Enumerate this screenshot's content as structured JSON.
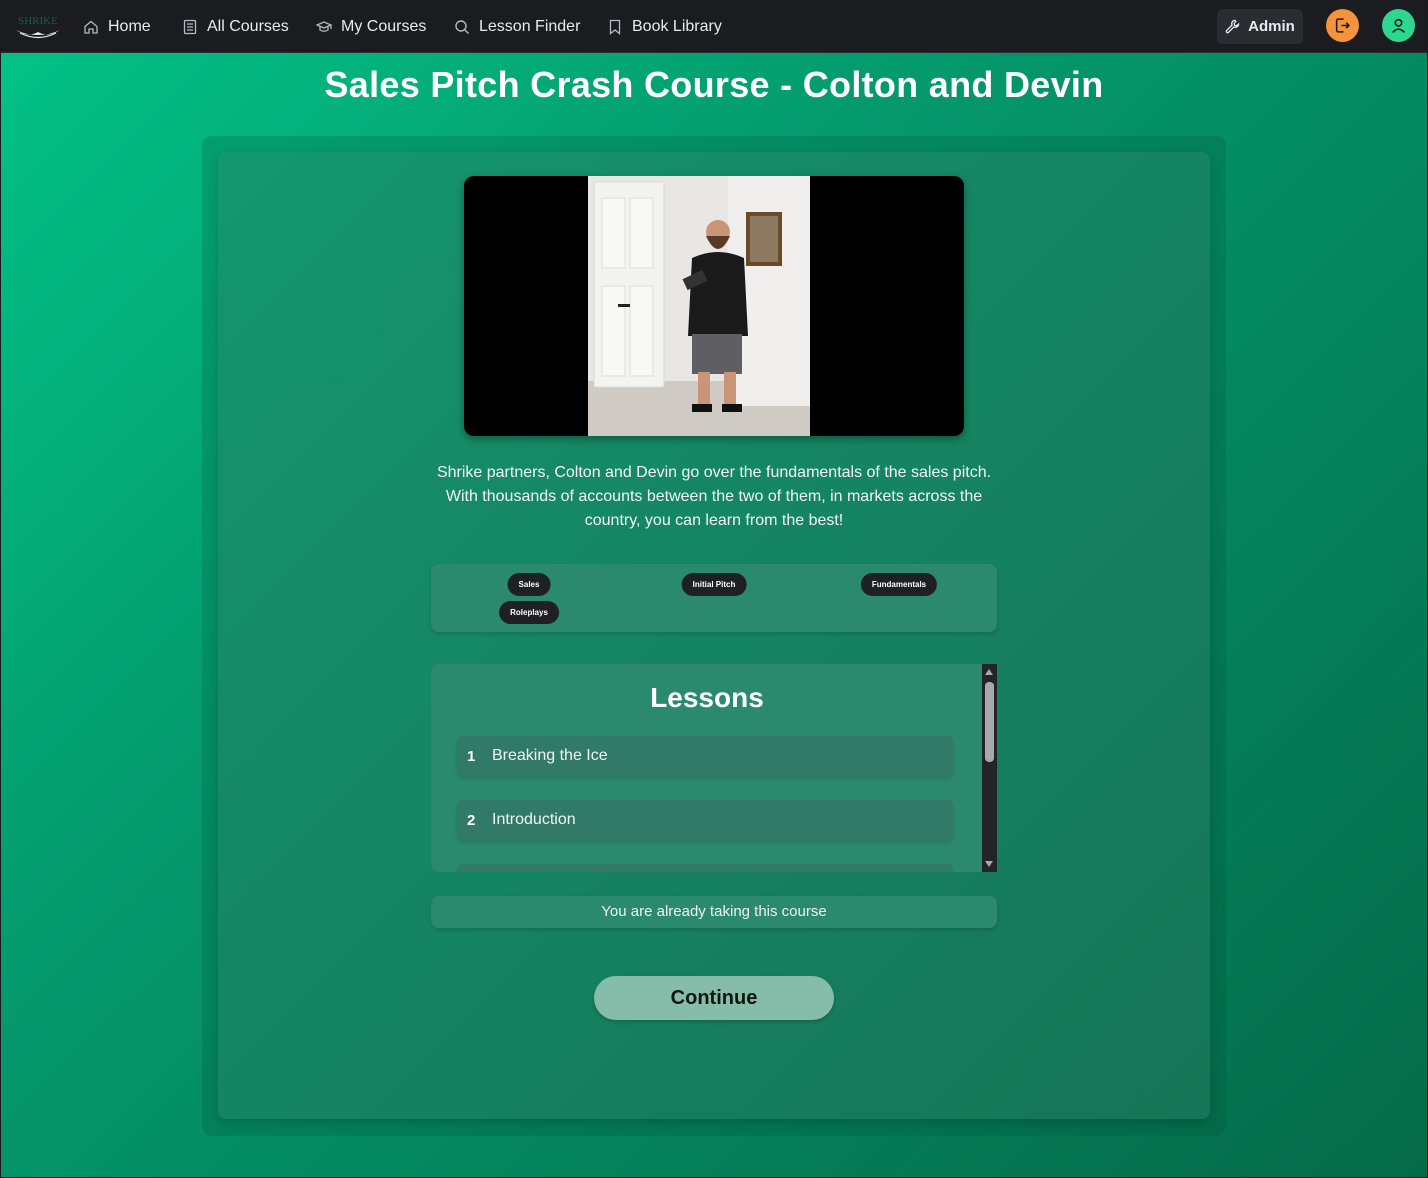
{
  "navbar": {
    "logo_text": "SHRIKE",
    "items": [
      {
        "label": "Home",
        "icon": "home-icon"
      },
      {
        "label": "All Courses",
        "icon": "document-icon"
      },
      {
        "label": "My Courses",
        "icon": "graduation-cap-icon"
      },
      {
        "label": "Lesson Finder",
        "icon": "search-icon"
      },
      {
        "label": "Book Library",
        "icon": "bookmark-icon"
      }
    ],
    "admin_label": "Admin",
    "admin_icon": "wrench-icon",
    "logout_icon": "logout-icon",
    "profile_icon": "user-icon"
  },
  "course": {
    "title": "Sales Pitch Crash Course - Colton and Devin",
    "description": "Shrike partners, Colton and Devin go over the fundamentals of the sales pitch. With thousands of accounts between the two of them, in markets across the country, you can learn from the best!",
    "tags": [
      "Sales",
      "Initial Pitch",
      "Fundamentals",
      "Roleplays"
    ]
  },
  "lessons": {
    "heading": "Lessons",
    "items": [
      {
        "number": "1",
        "title": "Breaking the Ice"
      },
      {
        "number": "2",
        "title": "Introduction"
      },
      {
        "number": "",
        "title": ""
      }
    ]
  },
  "status_text": "You are already taking this course",
  "continue_label": "Continue",
  "colors": {
    "navbar": "#1b1c20",
    "accent_green": "#2fd68f",
    "logout_orange": "#f5923c",
    "panel": "#2b8a6d",
    "continue_button": "#86bdaa"
  }
}
